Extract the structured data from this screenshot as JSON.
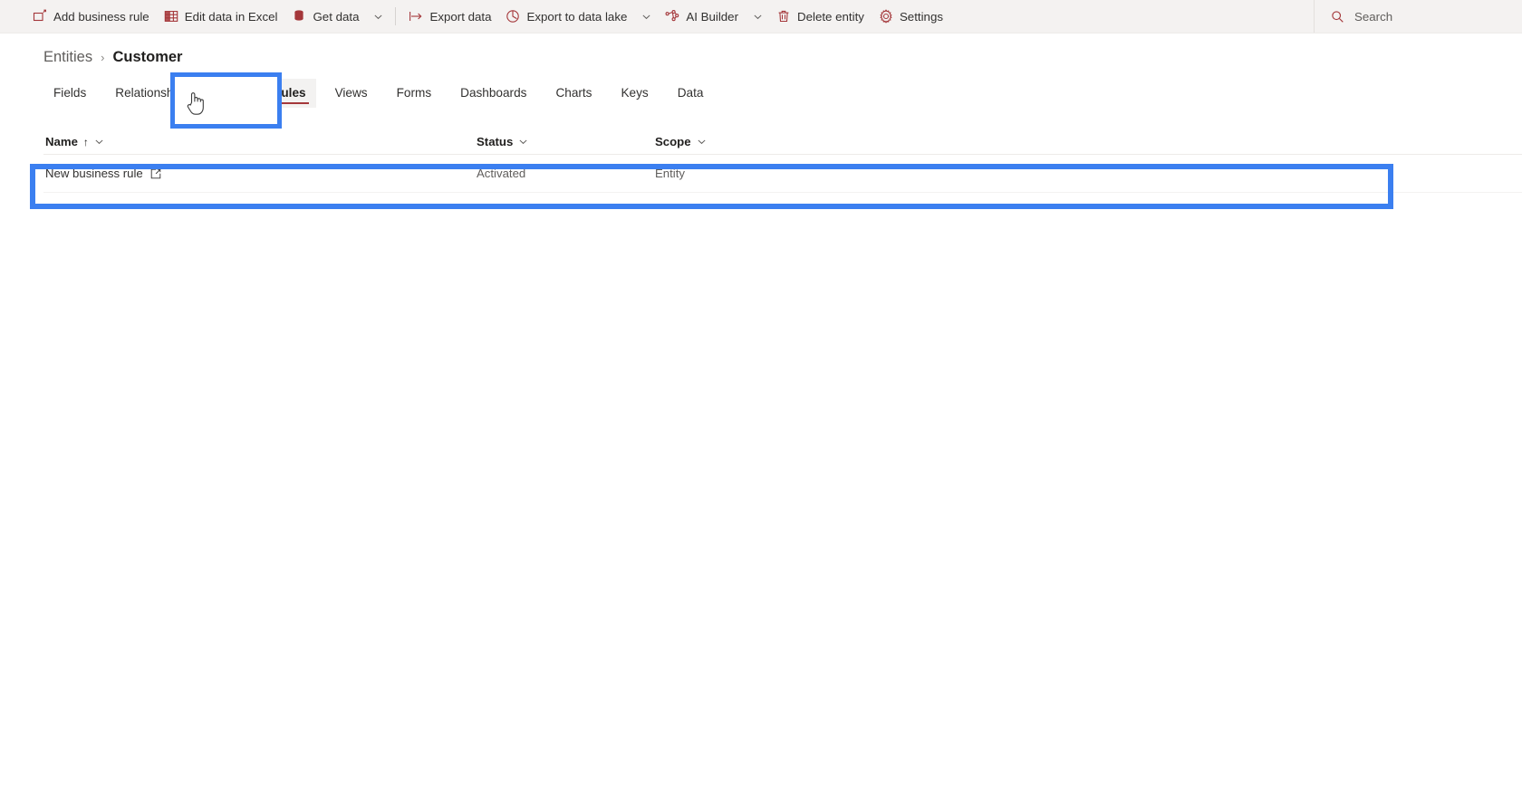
{
  "commandbar": {
    "commands": [
      {
        "label": "Add business rule",
        "icon": "add-business-rule-icon",
        "has_caret": false
      },
      {
        "label": "Edit data in Excel",
        "icon": "excel-icon",
        "has_caret": false
      },
      {
        "label": "Get data",
        "icon": "database-icon",
        "has_caret": true
      },
      {
        "label": "Export data",
        "icon": "export-icon",
        "has_caret": false
      },
      {
        "label": "Export to data lake",
        "icon": "data-lake-icon",
        "has_caret": true
      },
      {
        "label": "AI Builder",
        "icon": "ai-builder-icon",
        "has_caret": true
      },
      {
        "label": "Delete entity",
        "icon": "trash-icon",
        "has_caret": false
      },
      {
        "label": "Settings",
        "icon": "gear-icon",
        "has_caret": false
      }
    ],
    "search": {
      "placeholder": "Search",
      "value": "",
      "icon": "search-icon"
    }
  },
  "breadcrumb": {
    "parent": "Entities",
    "separator": "›",
    "current": "Customer"
  },
  "tabs": {
    "items": [
      {
        "label": "Fields",
        "selected": false
      },
      {
        "label": "Relationships",
        "selected": false
      },
      {
        "label": "Business rules",
        "selected": true
      },
      {
        "label": "Views",
        "selected": false
      },
      {
        "label": "Forms",
        "selected": false
      },
      {
        "label": "Dashboards",
        "selected": false
      },
      {
        "label": "Charts",
        "selected": false
      },
      {
        "label": "Keys",
        "selected": false
      },
      {
        "label": "Data",
        "selected": false
      }
    ]
  },
  "list": {
    "columns": [
      {
        "label": "Name",
        "sort": "↑",
        "chevron": true
      },
      {
        "label": "Status",
        "sort": "",
        "chevron": true
      },
      {
        "label": "Scope",
        "sort": "",
        "chevron": true
      }
    ],
    "rows": [
      {
        "name": "New business rule",
        "status": "Activated",
        "scope": "Entity",
        "open_icon": "open-in-new-icon"
      }
    ]
  },
  "annotations": {
    "highlight_color": "#3b7ff0",
    "tab_highlight_target": "Business rules",
    "row_highlight_target": "New business rule"
  },
  "theme": {
    "accent": "#a4373a",
    "commandbar_bg": "#f4f2f1",
    "text": "#323130"
  }
}
